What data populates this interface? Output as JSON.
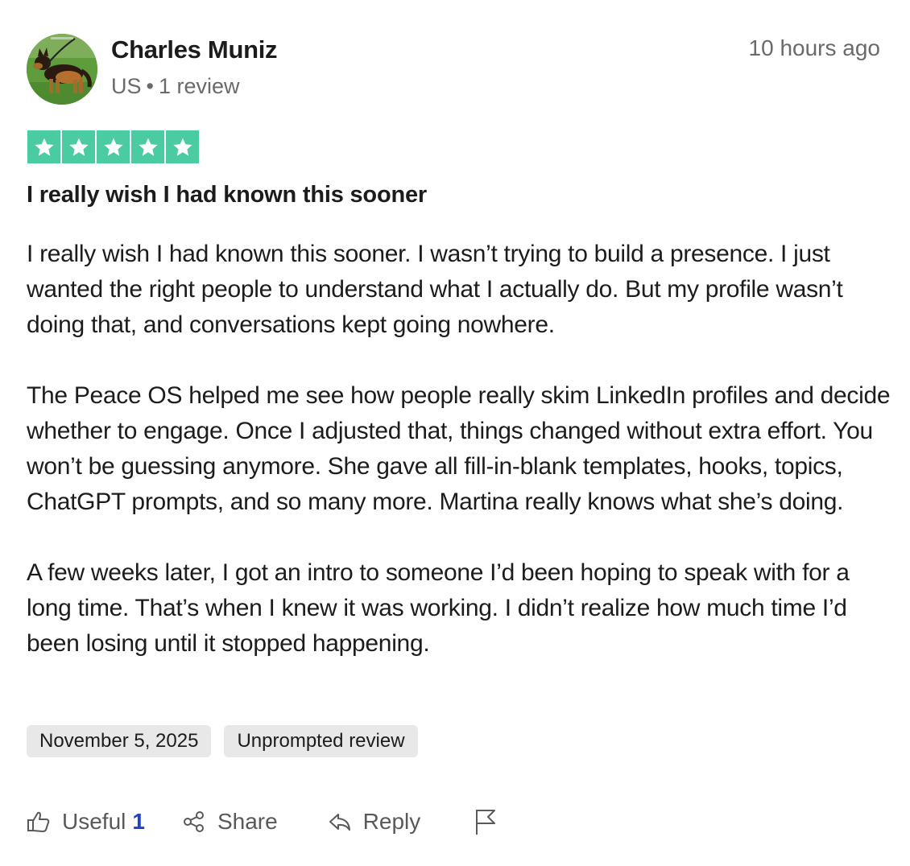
{
  "reviewer": {
    "name": "Charles Muniz",
    "country": "US",
    "separator": "•",
    "review_count": "1 review"
  },
  "timestamp": "10 hours ago",
  "rating": {
    "value": 5,
    "max": 5,
    "color": "#00b67a"
  },
  "review": {
    "title": "I really wish I had known this sooner",
    "paragraphs": [
      "I really wish I had known this sooner. I wasn’t trying to build a presence. I just wanted the right people to understand what I actually do. But my profile wasn’t doing that, and conversations kept going nowhere.",
      "The Peace OS helped me see how people really skim LinkedIn profiles and decide whether to engage. Once I adjusted that, things changed without extra effort. You won’t be guessing anymore. She gave all fill-in-blank templates, hooks, topics, ChatGPT prompts, and so many more. Martina really knows what she’s doing.",
      "A few weeks later, I got an intro to someone I’d been hoping to speak with for a long time. That’s when I knew it was working. I didn’t realize how much time I’d been losing until it stopped happening."
    ]
  },
  "chips": {
    "date": "November 5, 2025",
    "label": "Unprompted review"
  },
  "actions": {
    "useful_label": "Useful",
    "useful_count": "1",
    "share_label": "Share",
    "reply_label": "Reply"
  },
  "icons": {
    "avatar": "dog-avatar",
    "star": "star-icon",
    "useful": "thumbs-up-icon",
    "share": "share-icon",
    "reply": "reply-icon",
    "report": "flag-icon"
  },
  "colors": {
    "star_green": "#00b67a",
    "useful_count_blue": "#1e42c8",
    "muted_text": "#696a6a",
    "chip_bg": "#e8e8e8"
  }
}
